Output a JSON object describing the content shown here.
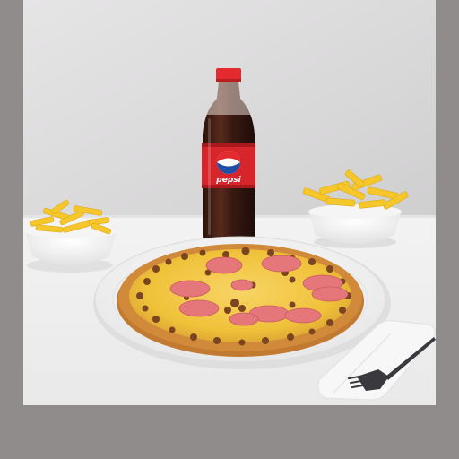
{
  "image": {
    "subject": "pizza-combo-with-pepsi-and-fries",
    "bottle": {
      "brand_label": "pepsi",
      "cap_color": "#e32a2f",
      "label_color": "#d6262c",
      "liquid_color": "#3a1a12"
    },
    "colors": {
      "border": "#8f8c8b",
      "wall": "#dcdbdc",
      "table": "#f1f1f1",
      "pizza_cheese": "#f0c23a",
      "pizza_crust": "#d08a3a",
      "ham": "#e5767a",
      "fries": "#f5c72a",
      "napkin": "#f7f7f7",
      "fork": "#3a3a3e"
    }
  }
}
